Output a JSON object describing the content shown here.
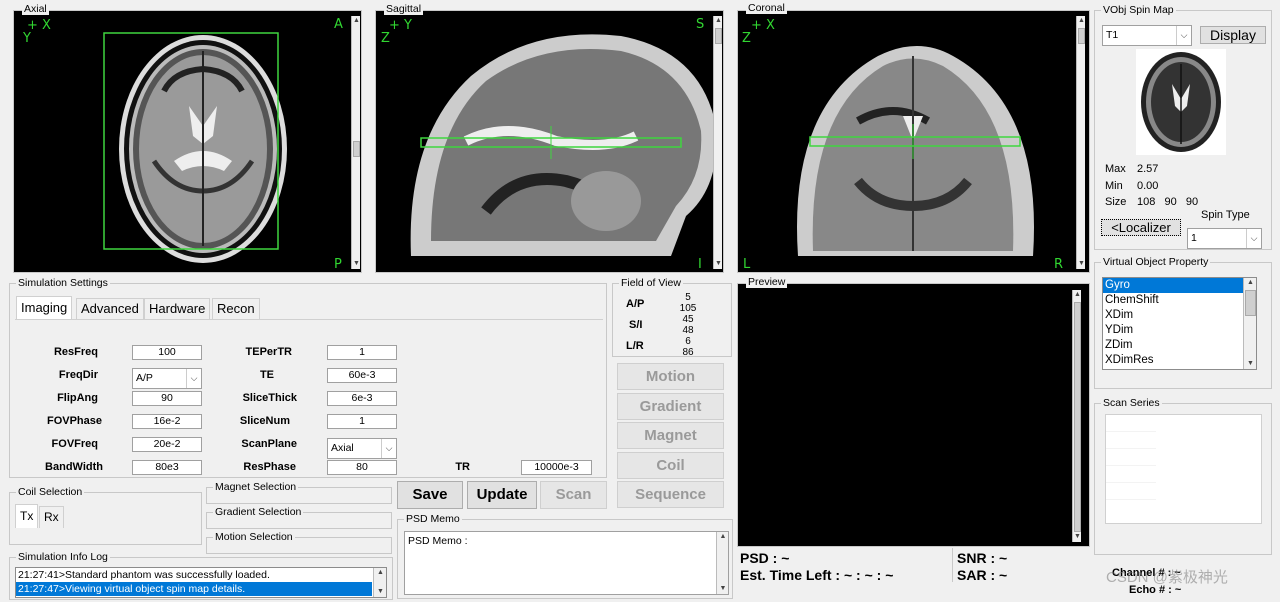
{
  "viewers": {
    "axial": {
      "title": "Axial",
      "tl_top": "+ X",
      "tl_bottom": "Y",
      "tr": "A",
      "br": "P"
    },
    "sagittal": {
      "title": "Sagittal",
      "tl_top": "+ Y",
      "tl_bottom": "Z",
      "tr": "S",
      "br": "I"
    },
    "coronal": {
      "title": "Coronal",
      "tl_top": "+ X",
      "tl_bottom": "Z",
      "bl": "L",
      "br": "R"
    }
  },
  "spin_map": {
    "title": "VObj Spin Map",
    "select_value": "T1",
    "display_button": "Display",
    "max_label": "Max",
    "max_value": "2.57",
    "min_label": "Min",
    "min_value": "0.00",
    "size_label": "Size",
    "size_value": "108   90   90",
    "localizer_button": "<Localizer",
    "spin_type_label": "Spin Type",
    "spin_type_value": "1"
  },
  "vobj_property": {
    "title": "Virtual Object Property",
    "items": [
      "Gyro",
      "ChemShift",
      "XDim",
      "YDim",
      "ZDim",
      "XDimRes"
    ],
    "selected_index": 0
  },
  "scan_series": {
    "title": "Scan Series"
  },
  "sim_settings": {
    "title": "Simulation Settings",
    "tabs": [
      "Imaging",
      "Advanced",
      "Hardware",
      "Recon"
    ],
    "active_tab": 0,
    "fields_left": [
      {
        "label": "ResFreq",
        "value": "100",
        "type": "input"
      },
      {
        "label": "FreqDir",
        "value": "A/P",
        "type": "select"
      },
      {
        "label": "FlipAng",
        "value": "90",
        "type": "input"
      },
      {
        "label": "FOVPhase",
        "value": "16e-2",
        "type": "input"
      },
      {
        "label": "FOVFreq",
        "value": "20e-2",
        "type": "input"
      },
      {
        "label": "BandWidth",
        "value": "80e3",
        "type": "input"
      }
    ],
    "fields_right": [
      {
        "label": "TEPerTR",
        "value": "1",
        "type": "input"
      },
      {
        "label": "TE",
        "value": "60e-3",
        "type": "input"
      },
      {
        "label": "SliceThick",
        "value": "6e-3",
        "type": "input"
      },
      {
        "label": "SliceNum",
        "value": "1",
        "type": "input"
      },
      {
        "label": "ScanPlane",
        "value": "Axial",
        "type": "select"
      },
      {
        "label": "ResPhase",
        "value": "80",
        "type": "input"
      }
    ],
    "tr_label": "TR",
    "tr_value": "10000e-3"
  },
  "fov": {
    "title": "Field of View",
    "rows": [
      {
        "label": "A/P",
        "top": "5",
        "bottom": "105"
      },
      {
        "label": "S/I",
        "top": "45",
        "bottom": "48"
      },
      {
        "label": "L/R",
        "top": "6",
        "bottom": "86"
      }
    ]
  },
  "side_buttons": [
    "Motion",
    "Gradient",
    "Magnet",
    "Coil",
    "Sequence"
  ],
  "preview": {
    "title": "Preview"
  },
  "coil_selection": {
    "title": "Coil Selection",
    "tabs": [
      "Tx",
      "Rx"
    ]
  },
  "magnet_selection": {
    "title": "Magnet Selection"
  },
  "gradient_selection": {
    "title": "Gradient Selection"
  },
  "motion_selection": {
    "title": "Motion Selection"
  },
  "action_buttons": {
    "save": "Save",
    "update": "Update",
    "scan": "Scan"
  },
  "psd_memo": {
    "title": "PSD Memo",
    "text": "PSD Memo :"
  },
  "sim_log": {
    "title": "Simulation Info Log",
    "lines": [
      "21:27:41>Standard phantom was successfully loaded.",
      "21:27:47>Viewing virtual object spin map details."
    ],
    "selected_index": 1
  },
  "status": {
    "psd": "PSD : ~",
    "time_left": "Est. Time Left : ~ : ~ : ~",
    "snr": "SNR : ~",
    "sar": "SAR : ~",
    "channel": "Channel # : ~",
    "echo": "Echo # : ~"
  },
  "watermark": "CSDN @紫极神光"
}
